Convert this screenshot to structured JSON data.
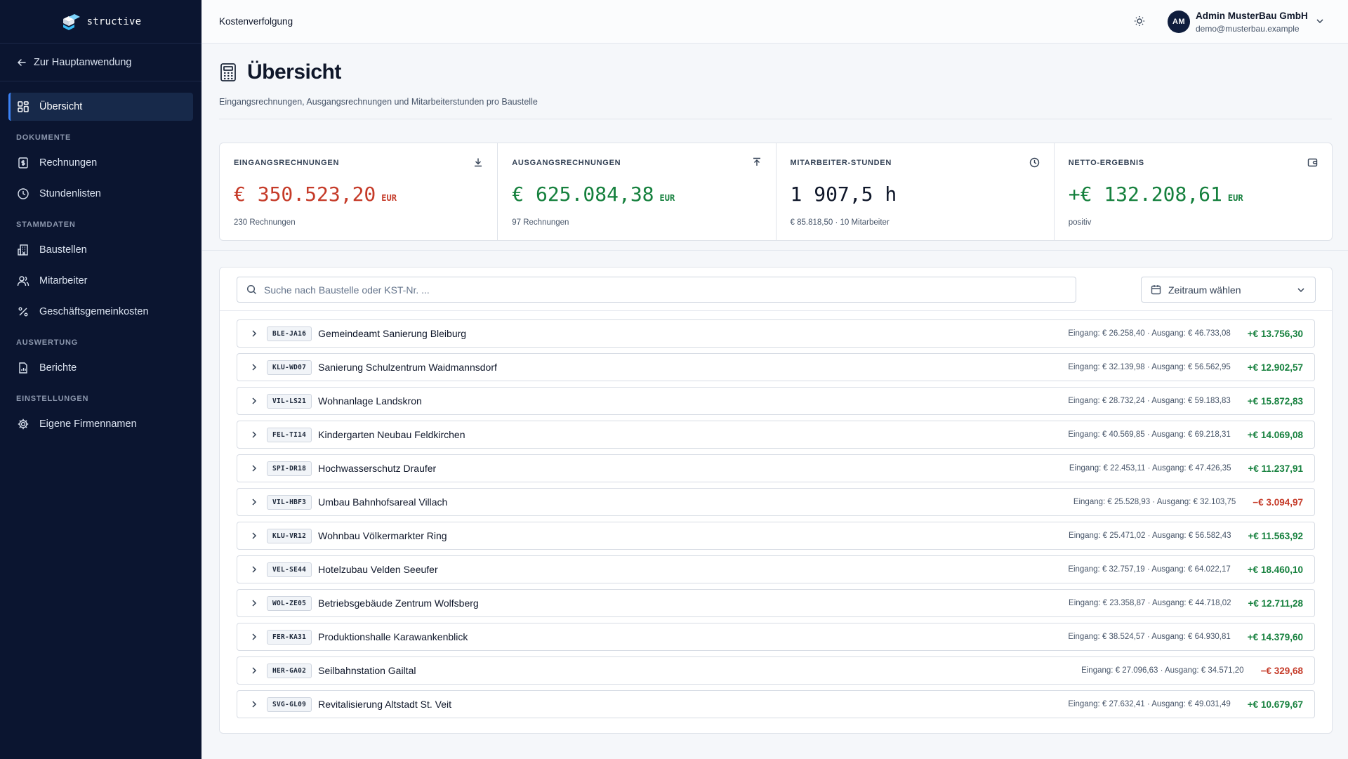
{
  "brand": {
    "name": "structive"
  },
  "sidebar": {
    "back_label": "Zur Hauptanwendung",
    "overview": "Übersicht",
    "sections": [
      {
        "title": "DOKUMENTE",
        "items": [
          {
            "label": "Rechnungen",
            "icon": "receipt-icon"
          },
          {
            "label": "Stundenlisten",
            "icon": "clock-icon"
          }
        ]
      },
      {
        "title": "STAMMDATEN",
        "items": [
          {
            "label": "Baustellen",
            "icon": "building-icon"
          },
          {
            "label": "Mitarbeiter",
            "icon": "users-icon"
          },
          {
            "label": "Geschäftsgemeinkosten",
            "icon": "percent-icon"
          }
        ]
      },
      {
        "title": "AUSWERTUNG",
        "items": [
          {
            "label": "Berichte",
            "icon": "report-icon"
          }
        ]
      },
      {
        "title": "EINSTELLUNGEN",
        "items": [
          {
            "label": "Eigene Firmennamen",
            "icon": "gear-icon"
          }
        ]
      }
    ]
  },
  "topbar": {
    "breadcrumb": "Kostenverfolgung",
    "user": {
      "initials": "AM",
      "name": "Admin MusterBau GmbH",
      "email": "demo@musterbau.example"
    }
  },
  "header": {
    "title": "Übersicht",
    "subtitle": "Eingangsrechnungen, Ausgangsrechnungen und Mitarbeiterstunden pro Baustelle"
  },
  "stats": [
    {
      "label": "EINGANGSRECHNUNGEN",
      "value": "€ 350.523,20",
      "unit": "EUR",
      "note": "230 Rechnungen",
      "tone": "red",
      "icon": "download-icon"
    },
    {
      "label": "AUSGANGSRECHNUNGEN",
      "value": "€ 625.084,38",
      "unit": "EUR",
      "note": "97 Rechnungen",
      "tone": "green",
      "icon": "upload-icon"
    },
    {
      "label": "MITARBEITER-STUNDEN",
      "value": "1 907,5 h",
      "unit": "",
      "note": "€ 85.818,50 · 10 Mitarbeiter",
      "tone": "dark",
      "icon": "clock-icon"
    },
    {
      "label": "NETTO-ERGEBNIS",
      "value": "+€ 132.208,61",
      "unit": "EUR",
      "note": "positiv",
      "tone": "green",
      "icon": "wallet-icon"
    }
  ],
  "filters": {
    "search_placeholder": "Suche nach Baustelle oder KST-Nr. ...",
    "period_label": "Zeitraum wählen"
  },
  "sites": [
    {
      "code": "BLE-JA16",
      "name": "Gemeindeamt Sanierung Bleiburg",
      "io": "Eingang: € 26.258,40 · Ausgang: € 46.733,08",
      "net": "+€ 13.756,30",
      "tone": "green"
    },
    {
      "code": "KLU-WD07",
      "name": "Sanierung Schulzentrum Waidmannsdorf",
      "io": "Eingang: € 32.139,98 · Ausgang: € 56.562,95",
      "net": "+€ 12.902,57",
      "tone": "green"
    },
    {
      "code": "VIL-LS21",
      "name": "Wohnanlage Landskron",
      "io": "Eingang: € 28.732,24 · Ausgang: € 59.183,83",
      "net": "+€ 15.872,83",
      "tone": "green"
    },
    {
      "code": "FEL-TI14",
      "name": "Kindergarten Neubau Feldkirchen",
      "io": "Eingang: € 40.569,85 · Ausgang: € 69.218,31",
      "net": "+€ 14.069,08",
      "tone": "green"
    },
    {
      "code": "SPI-DR18",
      "name": "Hochwasserschutz Draufer",
      "io": "Eingang: € 22.453,11 · Ausgang: € 47.426,35",
      "net": "+€ 11.237,91",
      "tone": "green"
    },
    {
      "code": "VIL-HBF3",
      "name": "Umbau Bahnhofsareal Villach",
      "io": "Eingang: € 25.528,93 · Ausgang: € 32.103,75",
      "net": "−€ 3.094,97",
      "tone": "red"
    },
    {
      "code": "KLU-VR12",
      "name": "Wohnbau Völkermarkter Ring",
      "io": "Eingang: € 25.471,02 · Ausgang: € 56.582,43",
      "net": "+€ 11.563,92",
      "tone": "green"
    },
    {
      "code": "VEL-SE44",
      "name": "Hotelzubau Velden Seeufer",
      "io": "Eingang: € 32.757,19 · Ausgang: € 64.022,17",
      "net": "+€ 18.460,10",
      "tone": "green"
    },
    {
      "code": "WOL-ZE05",
      "name": "Betriebsgebäude Zentrum Wolfsberg",
      "io": "Eingang: € 23.358,87 · Ausgang: € 44.718,02",
      "net": "+€ 12.711,28",
      "tone": "green"
    },
    {
      "code": "FER-KA31",
      "name": "Produktionshalle Karawankenblick",
      "io": "Eingang: € 38.524,57 · Ausgang: € 64.930,81",
      "net": "+€ 14.379,60",
      "tone": "green"
    },
    {
      "code": "HER-GA02",
      "name": "Seilbahnstation Gailtal",
      "io": "Eingang: € 27.096,63 · Ausgang: € 34.571,20",
      "net": "−€ 329,68",
      "tone": "red"
    },
    {
      "code": "SVG-GL09",
      "name": "Revitalisierung Altstadt St. Veit",
      "io": "Eingang: € 27.632,41 · Ausgang: € 49.031,49",
      "net": "+€ 10.679,67",
      "tone": "green"
    }
  ]
}
